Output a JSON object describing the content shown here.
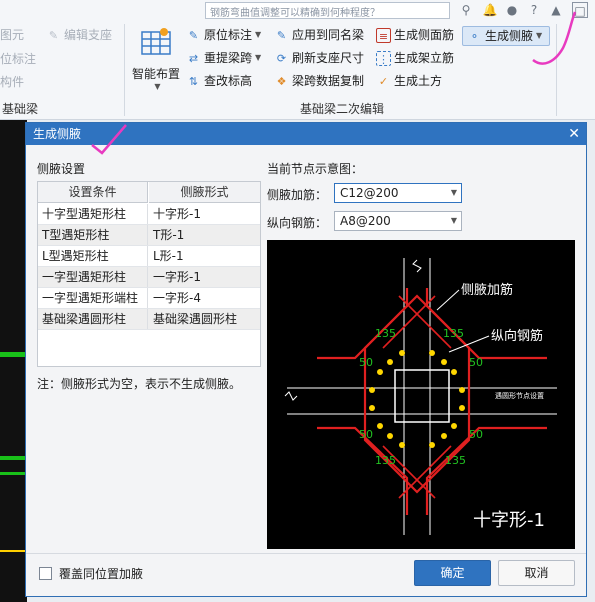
{
  "topbar": {
    "search_text": "钢筋弯曲值调整可以精确到何种程度？"
  },
  "ribbon": {
    "left_items": [
      "图元",
      "位标注",
      "构件"
    ],
    "edit_support_label": "编辑支座",
    "left_group_label": "基础梁",
    "smart_layout_label": "智能布置",
    "col1": [
      "原位标注",
      "重提梁跨",
      "查改标高"
    ],
    "col2": [
      "应用到同名梁",
      "刷新支座尺寸",
      "梁跨数据复制"
    ],
    "col3": [
      "生成侧面筋",
      "生成架立筋",
      "生成土方"
    ],
    "gen_side_button": "生成侧腋",
    "group_label": "基础梁二次编辑"
  },
  "dialog": {
    "title": "生成侧腋",
    "settings_title": "侧腋设置",
    "table": {
      "headers": [
        "设置条件",
        "侧腋形式"
      ],
      "rows": [
        [
          "十字型遇矩形柱",
          "十字形-1"
        ],
        [
          "T型遇矩形柱",
          "T形-1"
        ],
        [
          "L型遇矩形柱",
          "L形-1"
        ],
        [
          "一字型遇矩形柱",
          "一字形-1"
        ],
        [
          "一字型遇矩形端柱",
          "一字形-4"
        ],
        [
          "基础梁遇圆形柱",
          "基础梁遇圆形柱"
        ]
      ]
    },
    "note": "注：侧腋形式为空，表示不生成侧腋。",
    "preview_title": "当前节点示意图：",
    "side_rebar_label": "侧腋加筋：",
    "side_rebar_value": "C12@200",
    "long_rebar_label": "纵向钢筋：",
    "long_rebar_value": "A8@200",
    "diagram": {
      "label_side": "侧腋加筋",
      "label_long": "纵向钢筋",
      "label_round": "遇圆形节点设置",
      "dim_135": "135",
      "dim_50": "50",
      "caption": "十字形-1"
    },
    "overwrite_label": "覆盖同位置加腋",
    "ok_label": "确定",
    "cancel_label": "取消"
  },
  "colors": {
    "accent": "#2f73c0",
    "rebar_red": "#e02020",
    "dots_yellow": "#ffd700",
    "dim_green": "#22c322"
  }
}
